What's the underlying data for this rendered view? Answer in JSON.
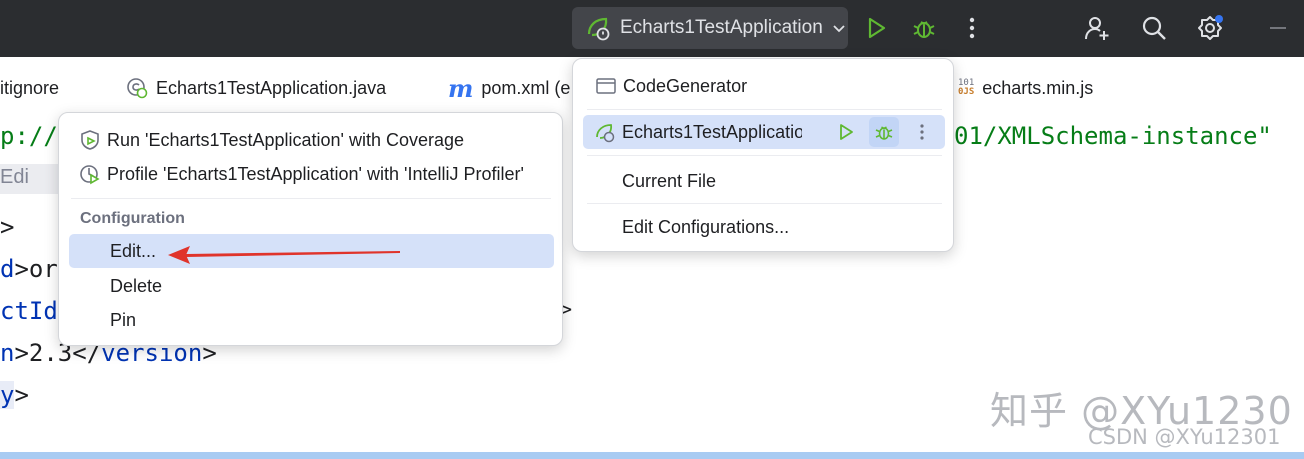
{
  "titlebar": {
    "run_config_label": "Echarts1TestApplication",
    "icons": [
      "run-icon",
      "debug-icon",
      "more-vertical-icon",
      "add-user-icon",
      "search-icon",
      "settings-icon",
      "minimize-icon"
    ]
  },
  "tabs": [
    {
      "label": "itignore",
      "icon": "file-icon"
    },
    {
      "label": "Echarts1TestApplication.java",
      "icon": "spring-class-icon"
    },
    {
      "label": "pom.xml (e",
      "icon": "maven-icon",
      "icon_text": "m"
    },
    {
      "label": "echarts.min.js",
      "icon": "js-file-icon",
      "icon_text_top": "101",
      "icon_text_bottom": "0JS"
    }
  ],
  "editor": {
    "line1_prefix": "p://",
    "line1_suffix": "01/XMLSchema-instance\"",
    "strip_label": "Edi",
    "line3": ">",
    "line4_tag": "d",
    "line4_text": ">or",
    "line5_tag": "ctId",
    "line5_trail": ">",
    "line6_tag": "n",
    "line6_text": ">2.3</",
    "line6_close": "version",
    "line6_end": ">",
    "line7_tag": "y",
    "line7_end": ">"
  },
  "context_menu": {
    "items": [
      {
        "label": "Run 'Echarts1TestApplication' with Coverage",
        "icon": "coverage-icon"
      },
      {
        "label": "Profile 'Echarts1TestApplication' with 'IntelliJ Profiler'",
        "icon": "profiler-icon"
      }
    ],
    "section_heading": "Configuration",
    "config_items": [
      {
        "label": "Edit...",
        "selected": true
      },
      {
        "label": "Delete",
        "selected": false
      },
      {
        "label": "Pin",
        "selected": false
      }
    ]
  },
  "run_config_popup": {
    "items": [
      {
        "label": "CodeGenerator",
        "icon": "application-icon"
      },
      {
        "label": "Echarts1TestApplicatio",
        "icon": "spring-boot-icon",
        "selected": true
      },
      {
        "label": "Current File"
      },
      {
        "label": "Edit Configurations..."
      }
    ]
  },
  "watermark": {
    "zhihu": "知乎 @XYu1230",
    "csdn": "CSDN @XYu12301"
  },
  "colors": {
    "titlebar_bg": "#2b2d30",
    "run_green": "#5fb832",
    "accent_blue": "#3574f0",
    "selection_bg": "#d5e1f9",
    "arrow_red": "#e0342b"
  }
}
